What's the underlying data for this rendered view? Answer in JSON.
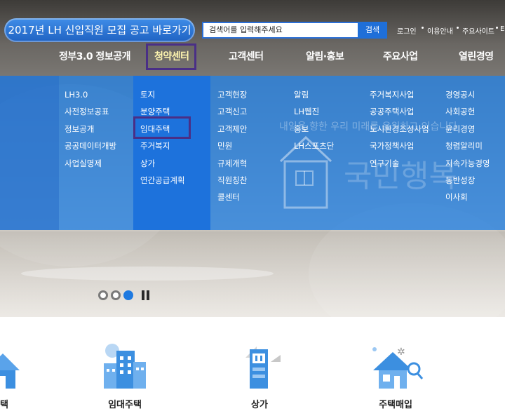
{
  "header": {
    "recruit_banner": "2017년 LH 신입직원 모집 공고 바로가기",
    "search": {
      "value": "검색어를 입력해주세요",
      "button": "검색"
    },
    "util_links": [
      "로그인",
      "이용안내",
      "주요사이트",
      "E"
    ]
  },
  "gnb": {
    "items": [
      "정부3.0 정보공개",
      "청약센터",
      "고객센터",
      "알림·홍보",
      "주요사업",
      "열린경영"
    ],
    "active": "청약센터"
  },
  "mega_menu": {
    "col1": [
      "LH3.0",
      "사전정보공표",
      "정보공개",
      "공공데이터개방",
      "사업실명제"
    ],
    "col2": [
      "토지",
      "분양주택",
      "임대주택",
      "주거복지",
      "상가",
      "연간공급계획"
    ],
    "col3": [
      "고객현장",
      "고객신고",
      "고객제안",
      "민원",
      "규제개혁",
      "직원칭찬",
      "콜센터"
    ],
    "col4": [
      "알림",
      "LH웹진",
      "홍보",
      "LH스포츠단"
    ],
    "col5": [
      "주거복지사업",
      "공공주택사업",
      "도시환경조성사업",
      "국가정책사업",
      "연구기술"
    ],
    "col6": [
      "경영공시",
      "사회공헌",
      "윤리경영",
      "청렴알리미",
      "지속가능경영",
      "동반성장",
      "이사회"
    ],
    "highlighted_item": "임대주택"
  },
  "hero": {
    "slogan": "내일을 향한 우리 미래를 응원하고 있습니다",
    "script_text": "국민행복"
  },
  "slider": {
    "dots": 3,
    "active_index": 2
  },
  "quick_menu": [
    "주택",
    "임대주택",
    "상가",
    "주택매입"
  ],
  "colors": {
    "menu_blue": "#2882e1",
    "active_blue": "#1d72dc",
    "highlight": "#4a2f86",
    "icon_blue": "#3c8fe0"
  }
}
